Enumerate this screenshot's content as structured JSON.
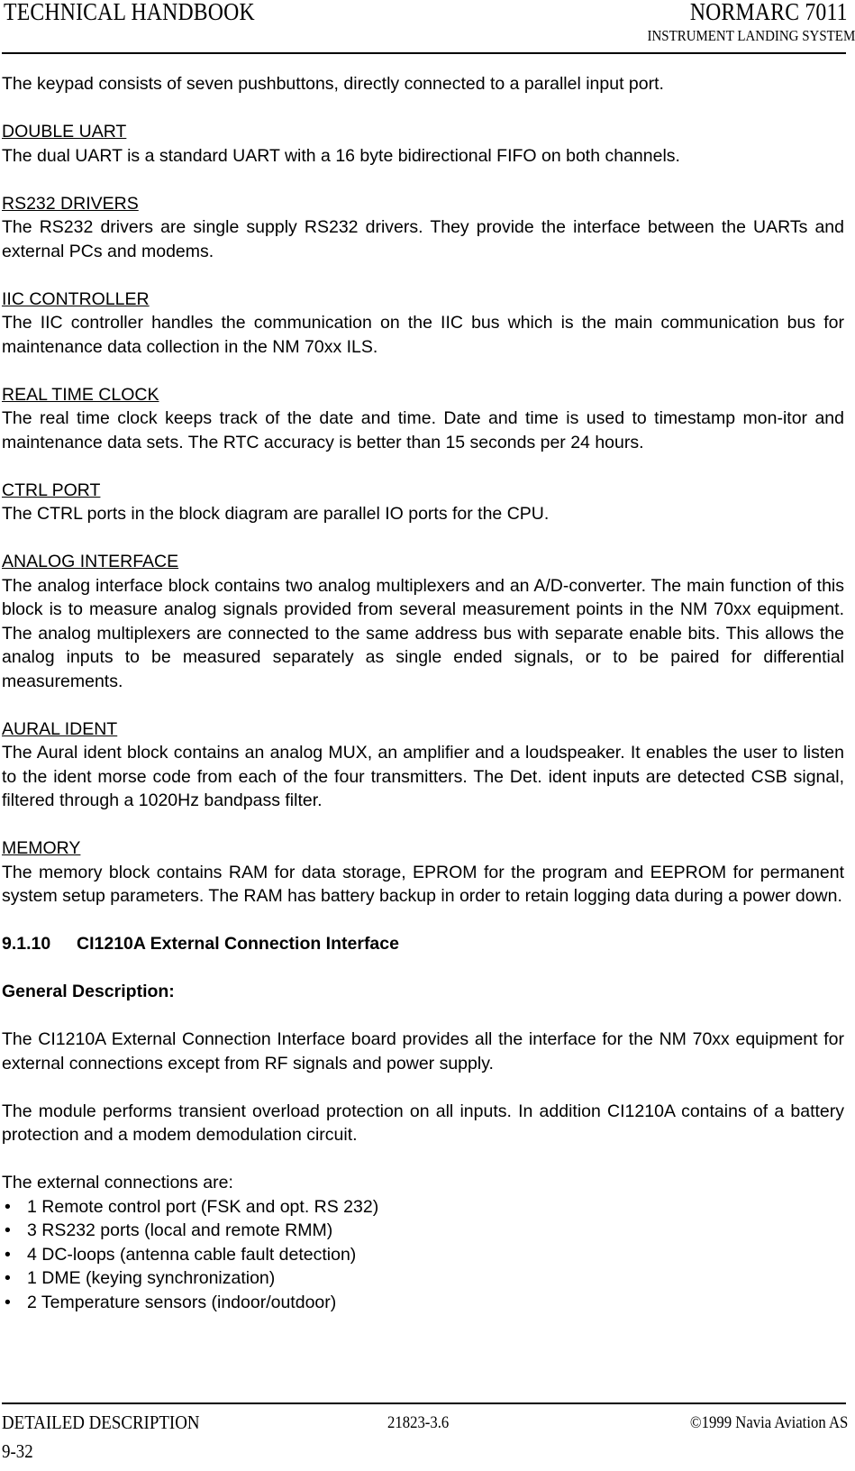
{
  "header": {
    "left_title": "TECHNICAL HANDBOOK",
    "right_title": "NORMARC 7011",
    "subtitle": "INSTRUMENT LANDING SYSTEM"
  },
  "body": {
    "intro_paragraph": "The keypad consists of seven pushbuttons, directly connected to a parallel input port.",
    "sections": [
      {
        "heading": "DOUBLE UART",
        "text": "The dual UART is a standard UART with a 16 byte bidirectional FIFO on both channels."
      },
      {
        "heading": "RS232 DRIVERS",
        "text": "The RS232 drivers are single supply RS232 drivers. They provide the interface between the UARTs and external PCs and modems."
      },
      {
        "heading": "IIC CONTROLLER",
        "text": "The IIC controller handles the communication on the IIC bus which is the main communication bus for maintenance data collection in the NM 70xx ILS."
      },
      {
        "heading": "REAL TIME CLOCK",
        "text": "The real time clock keeps track of the date and time. Date and time is used to timestamp mon-itor and maintenance data sets. The RTC accuracy is better than 15 seconds per 24 hours."
      },
      {
        "heading": "CTRL PORT",
        "text": "The CTRL ports in the block diagram are parallel IO ports for the CPU."
      },
      {
        "heading": "ANALOG INTERFACE",
        "text": "The analog interface block contains two analog multiplexers and an A/D-converter. The main function of this block is to measure analog signals provided from several measurement points in the NM 70xx equipment. The analog multiplexers are connected to the same address bus with separate enable bits. This allows the analog inputs to be measured separately as single ended signals, or to be paired for differential measurements."
      },
      {
        "heading": "AURAL IDENT",
        "text": "The Aural ident block contains an analog MUX, an amplifier and a loudspeaker. It enables the user to listen to the ident morse code from each of the four transmitters. The Det. ident inputs are detected CSB signal, filtered through a 1020Hz bandpass filter."
      },
      {
        "heading": "MEMORY",
        "text": "The memory block contains RAM for data storage, EPROM for the program and EEPROM for permanent system setup parameters. The RAM has battery backup in order to retain logging data during a power down."
      }
    ],
    "numbered_section": {
      "number": "9.1.10",
      "title": "CI1210A External Connection Interface",
      "sub_heading": "General Description:",
      "paragraph_1": "The CI1210A External Connection Interface board provides all the interface for the NM 70xx equipment for external connections except from RF signals and power supply.",
      "paragraph_2": "The module performs transient overload protection on all inputs. In addition CI1210A contains of a battery protection and a modem demodulation circuit.",
      "list_intro": "The external connections are:",
      "bullet_glyph": "•",
      "bullets": [
        "1 Remote control port (FSK and opt. RS 232)",
        "3 RS232 ports (local and remote RMM)",
        "4 DC-loops (antenna cable fault detection)",
        "1 DME (keying synchronization)",
        "2 Temperature sensors (indoor/outdoor)"
      ]
    }
  },
  "footer": {
    "left": "DETAILED DESCRIPTION",
    "center": "21823-3.6",
    "right": "©1999 Navia Aviation AS",
    "page_number": "9-32"
  }
}
